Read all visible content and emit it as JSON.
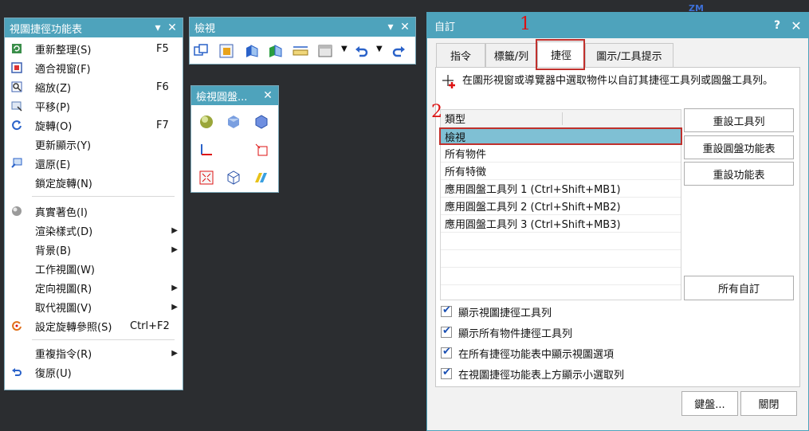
{
  "left_menu": {
    "title": "視圖捷徑功能表",
    "items": [
      {
        "label": "重新整理(S)",
        "shortcut": "F5",
        "icon": "refresh-icon"
      },
      {
        "label": "適合視窗(F)",
        "shortcut": "",
        "icon": "fit-window-icon"
      },
      {
        "label": "縮放(Z)",
        "shortcut": "F6",
        "icon": "zoom-icon"
      },
      {
        "label": "平移(P)",
        "shortcut": "",
        "icon": "pan-icon"
      },
      {
        "label": "旋轉(O)",
        "shortcut": "F7",
        "icon": "rotate-icon"
      },
      {
        "label": "更新顯示(Y)",
        "shortcut": "",
        "icon": ""
      },
      {
        "label": "還原(E)",
        "shortcut": "",
        "icon": "restore-icon"
      },
      {
        "label": "鎖定旋轉(N)",
        "shortcut": "",
        "icon": ""
      },
      {
        "label": "真實著色(I)",
        "shortcut": "",
        "icon": "true-shading-icon"
      },
      {
        "label": "渲染樣式(D)",
        "shortcut": "",
        "icon": ""
      },
      {
        "label": "背景(B)",
        "shortcut": "",
        "icon": ""
      },
      {
        "label": "工作視圖(W)",
        "shortcut": "",
        "icon": ""
      },
      {
        "label": "定向視圖(R)",
        "shortcut": "",
        "icon": ""
      },
      {
        "label": "取代視圖(V)",
        "shortcut": "",
        "icon": ""
      },
      {
        "label": "設定旋轉參照(S)",
        "shortcut": "Ctrl+F2",
        "icon": "rotate-ref-icon"
      },
      {
        "label": "重複指令(R)",
        "shortcut": "",
        "icon": ""
      },
      {
        "label": "復原(U)",
        "shortcut": "",
        "icon": "undo-icon"
      }
    ]
  },
  "view_toolbar": {
    "title": "檢視"
  },
  "view_radial": {
    "title": "檢視圓盤..."
  },
  "dialog": {
    "title": "自訂",
    "help": "?",
    "tabs": [
      "指令",
      "標籤/列",
      "捷徑",
      "圖示/工具提示"
    ],
    "instruction": "在圖形視窗或導覽器中選取物件以自訂其捷徑工具列或圓盤工具列。",
    "grid_header": "類型",
    "rows": [
      "檢視",
      "所有物件",
      "所有特徵",
      "應用圓盤工具列 1 (Ctrl+Shift+MB1)",
      "應用圓盤工具列 2 (Ctrl+Shift+MB2)",
      "應用圓盤工具列 3 (Ctrl+Shift+MB3)"
    ],
    "buttons": {
      "reset_toolbar": "重設工具列",
      "reset_radial": "重設圓盤功能表",
      "reset_menu": "重設功能表",
      "all_custom": "所有自訂",
      "keyboard": "鍵盤...",
      "close": "關閉"
    },
    "checkboxes": [
      {
        "label": "顯示視圖捷徑工具列",
        "checked": true
      },
      {
        "label": "顯示所有物件捷徑工具列",
        "checked": true
      },
      {
        "label": "在所有捷徑功能表中顯示視圖選項",
        "checked": true
      },
      {
        "label": "在視圖捷徑功能表上方顯示小選取列",
        "checked": true
      }
    ]
  },
  "annotations": {
    "one": "1",
    "two": "2"
  },
  "background_text": "ZM",
  "colors": {
    "accent": "#4ea3bc",
    "selected_row": "#7fc0d4",
    "highlight": "#c0302c"
  }
}
